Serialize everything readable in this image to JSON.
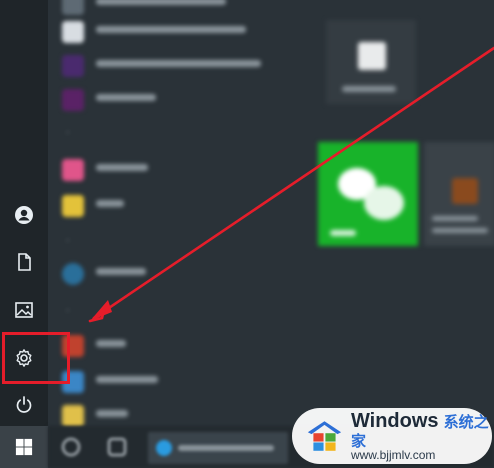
{
  "rail": {
    "items": [
      {
        "name": "user-icon"
      },
      {
        "name": "document-icon"
      },
      {
        "name": "pictures-icon"
      },
      {
        "name": "gear-icon"
      },
      {
        "name": "power-icon"
      }
    ]
  },
  "start": {
    "icon": "windows-logo-icon"
  },
  "colors": {
    "highlight": "#e51d2a",
    "arrow": "#e51d2a",
    "wechat_tile": "#18b32a",
    "rail_bg": "#1f2529",
    "panel_bg": "#2a3238"
  },
  "watermark": {
    "brand": "Windows",
    "cn": "系统之家",
    "url": "www.bjjmlv.com"
  }
}
